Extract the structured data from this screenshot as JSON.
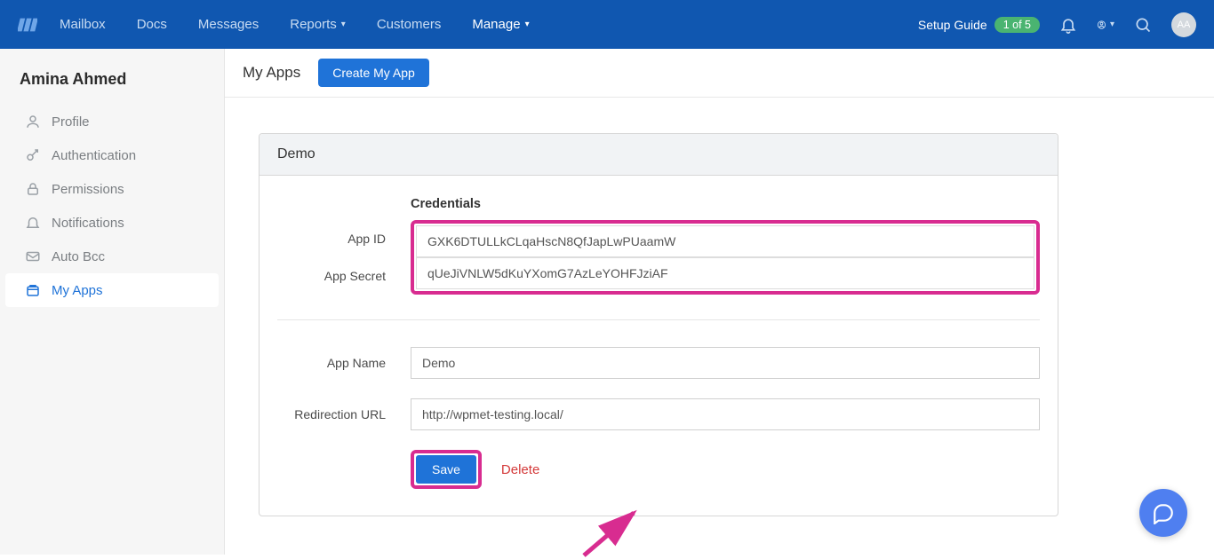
{
  "colors": {
    "accent": "#1f73d8",
    "highlight": "#d82c90",
    "success": "#4ab471",
    "danger": "#d43a3a"
  },
  "header": {
    "nav": [
      "Mailbox",
      "Docs",
      "Messages",
      "Reports",
      "Customers",
      "Manage"
    ],
    "active_nav": "Manage",
    "setup_guide_label": "Setup Guide",
    "setup_guide_pill": "1 of 5",
    "avatar_initials": "AA"
  },
  "sidebar": {
    "user_name": "Amina Ahmed",
    "items": [
      {
        "icon": "person-icon",
        "label": "Profile"
      },
      {
        "icon": "key-icon",
        "label": "Authentication"
      },
      {
        "icon": "lock-icon",
        "label": "Permissions"
      },
      {
        "icon": "bell-icon",
        "label": "Notifications"
      },
      {
        "icon": "mail-icon",
        "label": "Auto Bcc"
      },
      {
        "icon": "apps-icon",
        "label": "My Apps"
      }
    ],
    "active": "My Apps"
  },
  "subheader": {
    "title": "My Apps",
    "create_button": "Create My App"
  },
  "card": {
    "title": "Demo",
    "credentials_label": "Credentials",
    "app_id_label": "App ID",
    "app_id_value": "GXK6DTULLkCLqaHscN8QfJapLwPUaamW",
    "app_secret_label": "App Secret",
    "app_secret_value": "qUeJiVNLW5dKuYXomG7AzLeYOHFJziAF",
    "app_name_label": "App Name",
    "app_name_value": "Demo",
    "redirect_label": "Redirection URL",
    "redirect_value": "http://wpmet-testing.local/",
    "save_label": "Save",
    "delete_label": "Delete"
  }
}
